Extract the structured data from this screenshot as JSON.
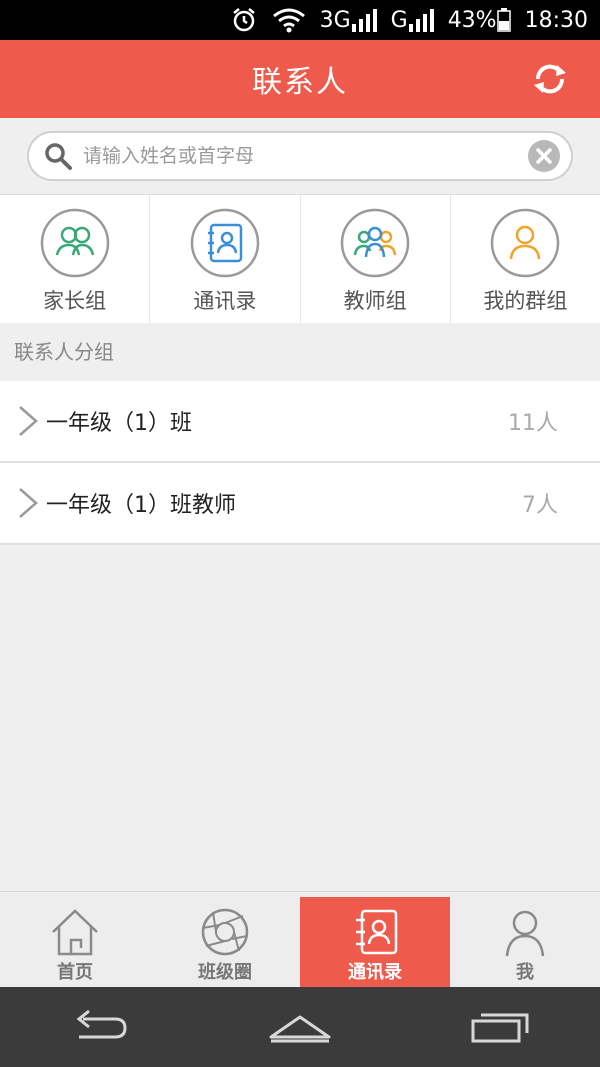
{
  "status_bar": {
    "network1": "3G",
    "network2": "G",
    "battery": "43%",
    "time": "18:30"
  },
  "header": {
    "title": "联系人",
    "refresh_icon": "refresh-icon"
  },
  "search": {
    "placeholder": "请输入姓名或首字母",
    "value": ""
  },
  "quick_links": [
    {
      "label": "家长组",
      "icon": "parents-group-icon",
      "color": "#3aa776"
    },
    {
      "label": "通讯录",
      "icon": "contacts-book-icon",
      "color": "#3a8fd6"
    },
    {
      "label": "教师组",
      "icon": "teachers-group-icon",
      "color": "#3a8fd6"
    },
    {
      "label": "我的群组",
      "icon": "my-group-icon",
      "color": "#f0a42a"
    }
  ],
  "section": {
    "title": "联系人分组"
  },
  "groups": [
    {
      "name": "一年级（1）班",
      "count": "11人"
    },
    {
      "name": "一年级（1）班教师",
      "count": "7人"
    }
  ],
  "tabs": [
    {
      "label": "首页",
      "icon": "home-icon",
      "active": false
    },
    {
      "label": "班级圈",
      "icon": "aperture-icon",
      "active": false
    },
    {
      "label": "通讯录",
      "icon": "contacts-icon",
      "active": true
    },
    {
      "label": "我",
      "icon": "person-icon",
      "active": false
    }
  ],
  "colors": {
    "accent": "#ee5a4b",
    "background": "#efefef"
  }
}
